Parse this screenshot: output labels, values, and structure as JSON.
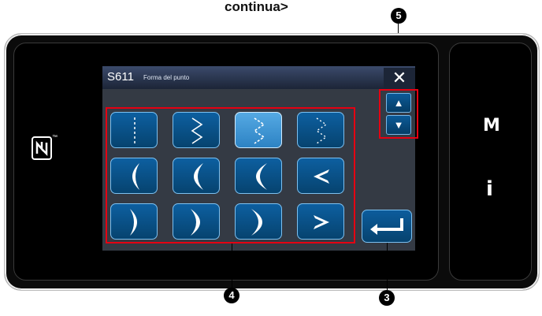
{
  "caption": "continua>",
  "title": {
    "code": "S611",
    "text": "Forma del punto"
  },
  "close_glyph": "✕",
  "side": {
    "menu_label": "M",
    "info_label": "i",
    "nfc_icon": "nfc-icon"
  },
  "arrows": {
    "up": "▲",
    "down": "▼"
  },
  "callouts": {
    "stitch_buttons": "4",
    "enter": "3",
    "scroll": "5"
  },
  "stitch_buttons": [
    {
      "icon": "straight-stitch-icon",
      "selected": false
    },
    {
      "icon": "zigzag-stitch-icon",
      "selected": false
    },
    {
      "icon": "zigzag-dotted-stitch-icon",
      "selected": true
    },
    {
      "icon": "zigzag-dotted-fine-stitch-icon",
      "selected": false
    },
    {
      "icon": "crescent-left-narrow-icon",
      "selected": false
    },
    {
      "icon": "crescent-left-medium-icon",
      "selected": false
    },
    {
      "icon": "crescent-left-wide-icon",
      "selected": false
    },
    {
      "icon": "chevron-left-stitch-icon",
      "selected": false
    },
    {
      "icon": "crescent-right-narrow-icon",
      "selected": false
    },
    {
      "icon": "crescent-right-medium-icon",
      "selected": false
    },
    {
      "icon": "crescent-right-wide-icon",
      "selected": false
    },
    {
      "icon": "chevron-right-stitch-icon",
      "selected": false
    }
  ],
  "colors": {
    "accent_red": "#e50012",
    "button_blue": "#0d5fa0",
    "button_selected": "#55a9e3"
  }
}
